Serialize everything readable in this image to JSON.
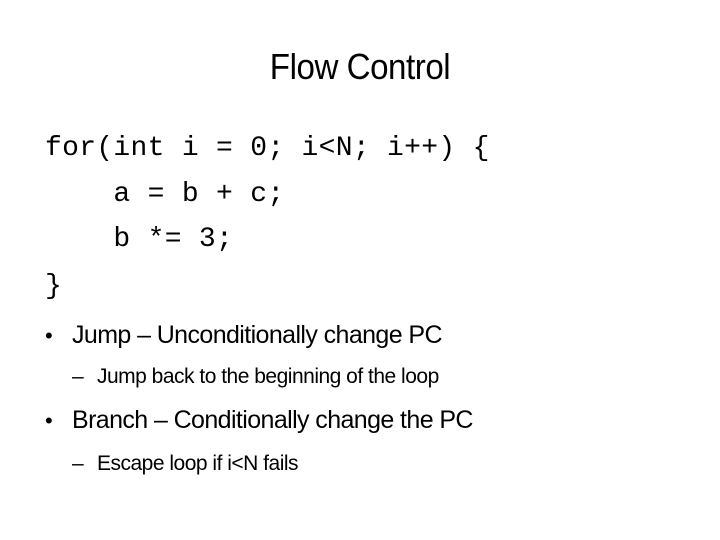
{
  "slide": {
    "title": "Flow Control",
    "code_lines": [
      "for(int i = 0; i<N; i++) {",
      "    a = b + c;",
      "    b *= 3;",
      "}"
    ],
    "bullets": [
      {
        "marker": "•",
        "text": "Jump – Unconditionally change PC",
        "sub_marker": "–",
        "sub_text": "Jump back to the beginning of the loop"
      },
      {
        "marker": "•",
        "text": "Branch – Conditionally change the PC",
        "sub_marker": "–",
        "sub_text": "Escape loop if i<N fails"
      }
    ]
  }
}
